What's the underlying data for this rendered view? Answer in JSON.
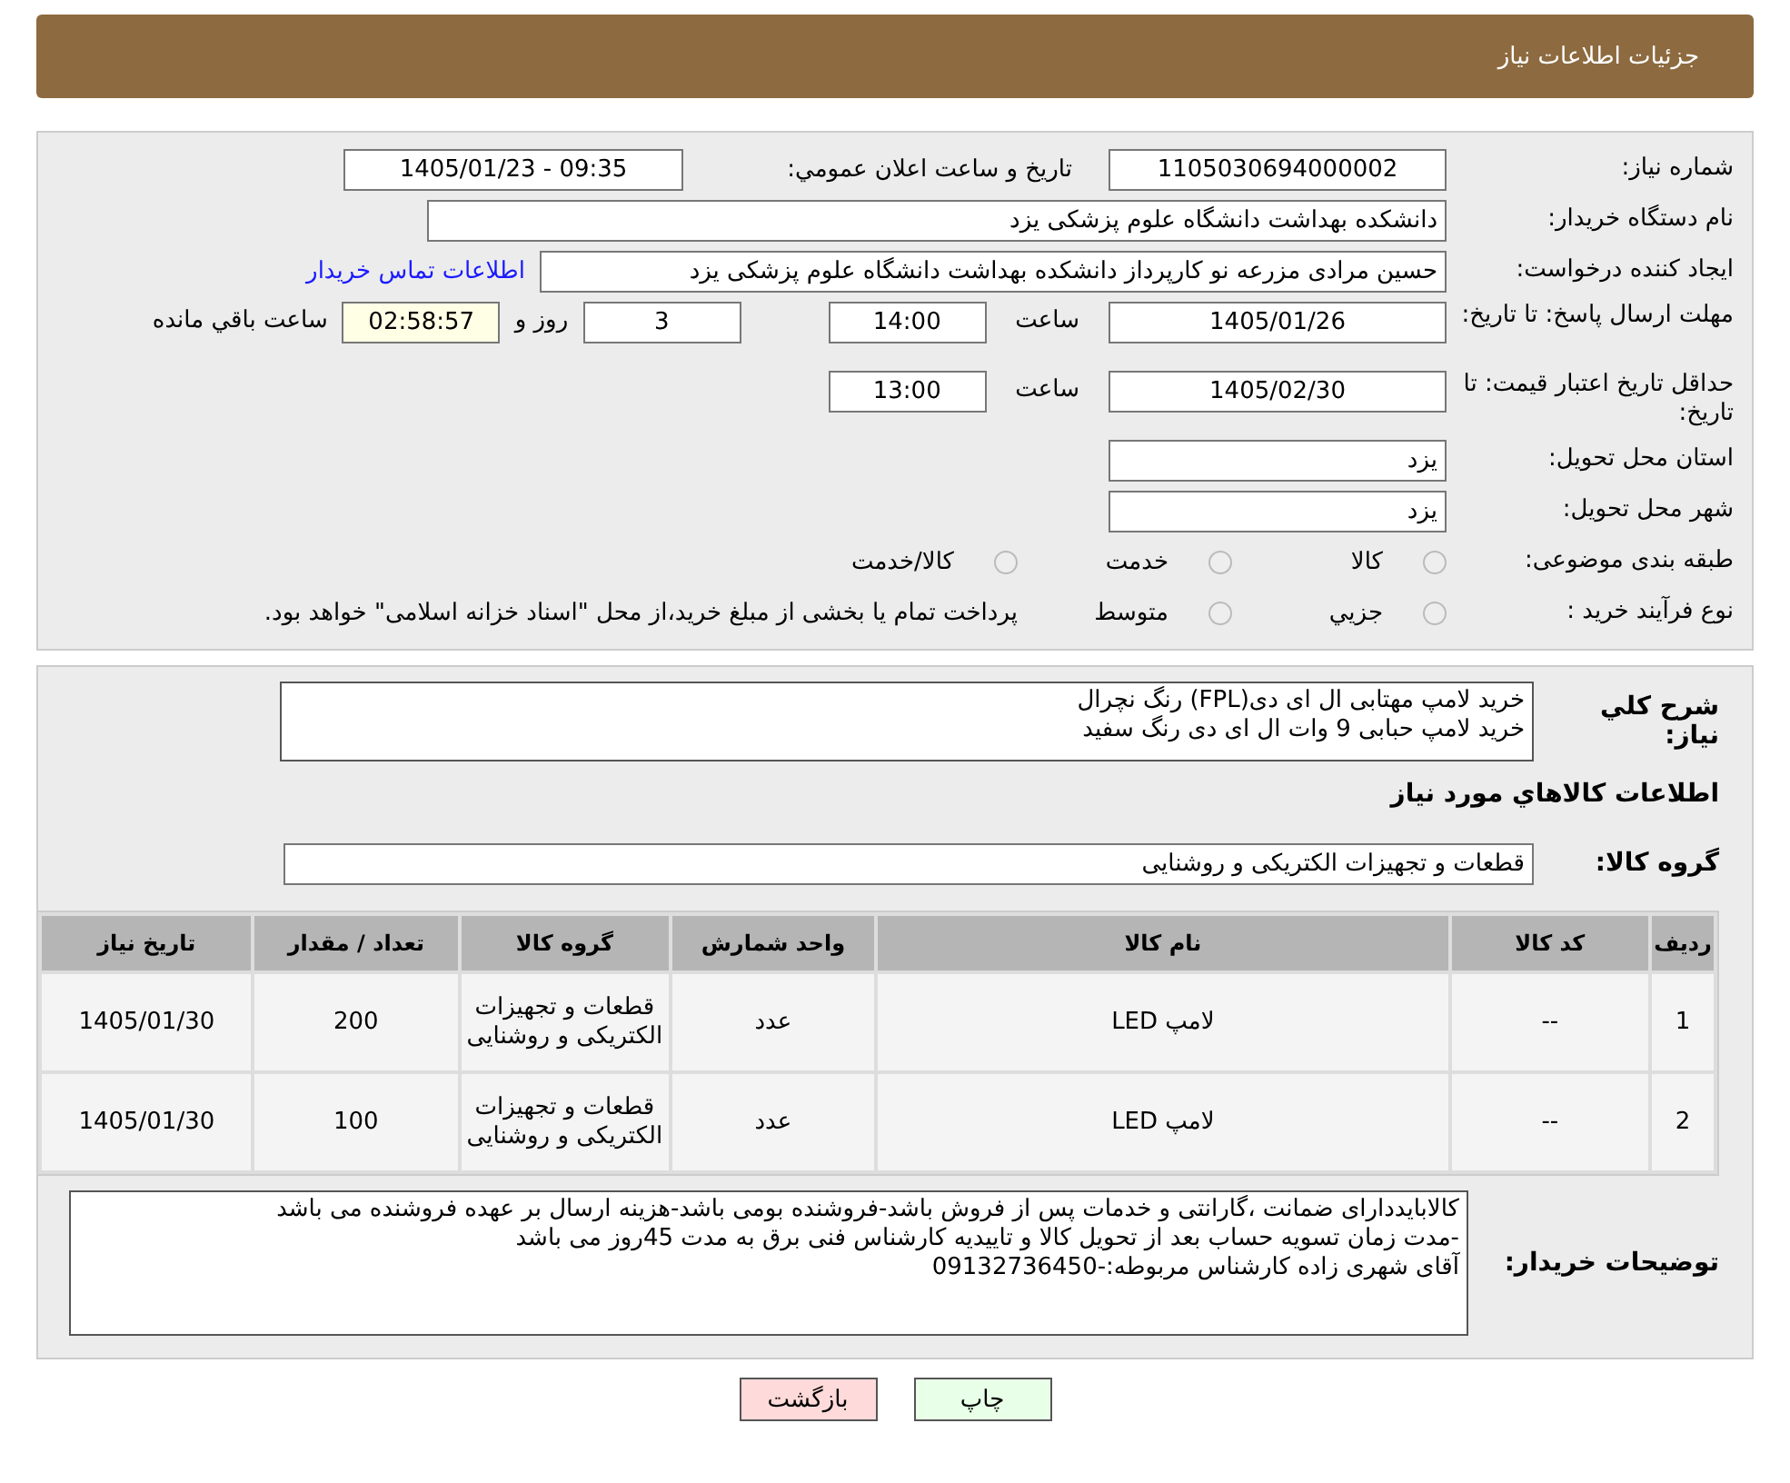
{
  "header": {
    "title": "جزئیات اطلاعات نیاز"
  },
  "details": {
    "need_number": {
      "label": "شماره نیاز:",
      "value": "1105030694000002"
    },
    "announce": {
      "label": "تاريخ و ساعت اعلان عمومي:",
      "value": "1405/01/23 - 09:35"
    },
    "buyer_org": {
      "label": "نام دستگاه خريدار:",
      "value": "دانشکده بهداشت دانشگاه علوم پزشکی یزد"
    },
    "requester": {
      "label": "ایجاد کننده درخواست:",
      "value": "حسین مرادی مزرعه نو کارپرداز دانشکده بهداشت دانشگاه علوم پزشکی یزد",
      "link": "اطلاعات تماس خریدار"
    },
    "reply_deadline": {
      "label": "مهلت ارسال پاسخ: تا تاریخ:",
      "date": "1405/01/26",
      "time_label": "ساعت",
      "time": "14:00",
      "days": "3",
      "days_label": "روز و",
      "remaining": "02:58:57",
      "remaining_label": "ساعت باقي مانده"
    },
    "price_validity": {
      "label": "حداقل تاریخ اعتبار قیمت: تا تاریخ:",
      "date": "1405/02/30",
      "time_label": "ساعت",
      "time": "13:00"
    },
    "province": {
      "label": "استان محل تحویل:",
      "value": "یزد"
    },
    "city": {
      "label": "شهر محل تحویل:",
      "value": "یزد"
    },
    "category": {
      "label": "طبقه بندی موضوعی:",
      "options": [
        {
          "label": "کالا",
          "selected": false
        },
        {
          "label": "خدمت",
          "selected": false
        },
        {
          "label": "کالا/خدمت",
          "selected": false
        }
      ]
    },
    "process": {
      "label": "نوع فرآیند خرید :",
      "options": [
        {
          "label": "جزيي",
          "selected": false
        },
        {
          "label": "متوسط",
          "selected": false
        }
      ],
      "note": "پرداخت تمام یا بخشی از مبلغ خرید،از محل \"اسناد خزانه اسلامی\" خواهد بود."
    }
  },
  "summary": {
    "label": "شرح کلي نياز:",
    "lines": [
      "خرید لامپ مهتابی ال ای دی(FPL) رنگ نچرال",
      "خرید لامپ حبابی 9 وات ال ای دی رنگ سفید"
    ]
  },
  "goods_title": "اطلاعات کالاهاي مورد نياز",
  "goods_group": {
    "label": "گروه کالا:",
    "value": "قطعات و تجهیزات الکتریکی و روشنایی"
  },
  "table": {
    "columns": [
      "رديف",
      "کد کالا",
      "نام کالا",
      "واحد شمارش",
      "گروه کالا",
      "تعداد / مقدار",
      "تاريخ نياز"
    ],
    "rows": [
      [
        "1",
        "--",
        "لامپ LED",
        "عدد",
        "قطعات و تجهیزات الکتریکی و روشنایی",
        "200",
        "1405/01/30"
      ],
      [
        "2",
        "--",
        "لامپ LED",
        "عدد",
        "قطعات و تجهیزات الکتریکی و روشنایی",
        "100",
        "1405/01/30"
      ]
    ]
  },
  "buyer_notes": {
    "label": "توضیحات خریدار:",
    "lines": [
      "کالابایددارای ضمانت ،گارانتی و خدمات پس از فروش باشد-فروشنده بومی باشد-هزینه ارسال بر عهده فروشنده می باشد",
      "-مدت زمان تسویه حساب بعد از تحویل کالا و تاییدیه کارشناس فنی برق به مدت 45روز می باشد",
      "آقای شهری زاده کارشناس مربوطه:-09132736450"
    ]
  },
  "buttons": [
    {
      "kind": "print",
      "label": "چاپ"
    },
    {
      "kind": "back",
      "label": "بازگشت"
    }
  ]
}
